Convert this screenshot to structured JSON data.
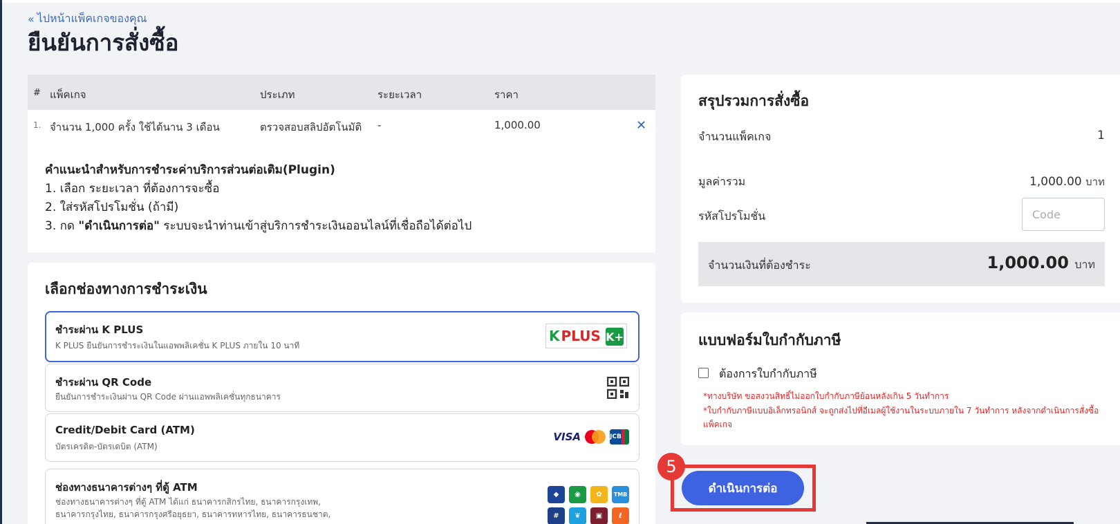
{
  "header": {
    "back_link": "ไปหน้าแพ็คเกจของคุณ",
    "title": "ยืนยันการสั่งซื้อ"
  },
  "package_table": {
    "columns": [
      "#",
      "แพ็คเกจ",
      "ประเภท",
      "ระยะเวลา",
      "ราคา"
    ],
    "rows": [
      {
        "index": "1.",
        "package": "จำนวน 1,000 ครั้ง ใช้ได้นาน 3 เดือน",
        "type": "ตรวจสอบสลิปอัตโนมัติ",
        "duration": "-",
        "price": "1,000.00"
      }
    ]
  },
  "instructions": {
    "heading": "คำแนะนำสำหรับการชำระค่าบริการส่วนต่อเติม(Plugin)",
    "step1": "1. เลือก ระยะเวลา ที่ต้องการจะซื้อ",
    "step2": "2. ใส่รหัสโปรโมชั่น (ถ้ามี)",
    "step3_prefix": "3. กด ",
    "step3_bold": "\"ดำเนินการต่อ\"",
    "step3_suffix": " ระบบจะนำท่านเข้าสู่บริการชำระเงินออนไลน์ที่เชื่อถือได้ต่อไป"
  },
  "payment": {
    "title": "เลือกช่องทางการชำระเงิน",
    "options": [
      {
        "title": "ชำระผ่าน K PLUS",
        "desc": "K PLUS ยืนยันการชำระเงินในแอพพลิเคชั่น K PLUS ภายใน 10 นาที",
        "icon": "kplus-logo"
      },
      {
        "title": "ชำระผ่าน QR Code",
        "desc": "ยืนยันการชำระเงินผ่าน QR Code ผ่านแอพพลิเคชั่นทุกธนาคาร",
        "icon": "qr-code-icon"
      },
      {
        "title": "Credit/Debit Card (ATM)",
        "desc": "บัตรเครดิต-บัตรเดบิต (ATM)",
        "icon": "card-logos"
      },
      {
        "title": "ช่องทางธนาคารต่างๆ ที่ตู้ ATM",
        "desc_line1": "ช่องทางธนาคารต่างๆ ที่ตู้ ATM ได้แก่ ธนาคารกสิกรไทย, ธนาคารกรุงเทพ,",
        "desc_line2": "ธนาคารกรุงไทย, ธนาคารกรุงศรีอยุธยา, ธนาคารทหารไทย, ธนาคารธนชาต,",
        "icon": "bank-logos"
      }
    ],
    "kplus_text": {
      "k": "K",
      "plus": "PLUS",
      "box": "K+"
    },
    "card_text": {
      "visa": "VISA",
      "jcb": "JCB"
    },
    "tmb_text": "TMB",
    "colors": {
      "selected_border": "#3d63e0",
      "kplus_green": "#1a9a45"
    }
  },
  "summary": {
    "title": "สรุปรวมการสั่งซื้อ",
    "package_count_label": "จำนวนแพ็คเกจ",
    "package_count": "1",
    "total_value_label": "มูลค่ารวม",
    "total_value": "1,000.00",
    "unit": "บาท",
    "promo_label": "รหัสโปรโมชั่น",
    "promo_placeholder": "Code",
    "amount_due_label": "จำนวนเงินที่ต้องชำระ",
    "amount_due": "1,000.00"
  },
  "tax_invoice": {
    "title": "แบบฟอร์มใบกำกับภาษี",
    "checkbox_label": "ต้องการใบกำกับภาษี",
    "checked": false,
    "note1": "*ทางบริษัท ขอสงวนสิทธิ์ไม่ออกใบกำกับภาษีย้อนหลังเกิน 5 วันทำการ",
    "note2": "*ใบกำกับภาษีแบบอิเล็กทรอนิกส์ จะถูกส่งไปที่อีเมลผู้ใช้งานในระบบภายใน 7 วันทำการ หลังจากดำเนินการสั่งซื้อแพ็คเกจ"
  },
  "action": {
    "continue_label": "ดำเนินการต่อ",
    "step_number": "5",
    "accent": "#3d63e0",
    "highlight": "#e53935"
  }
}
